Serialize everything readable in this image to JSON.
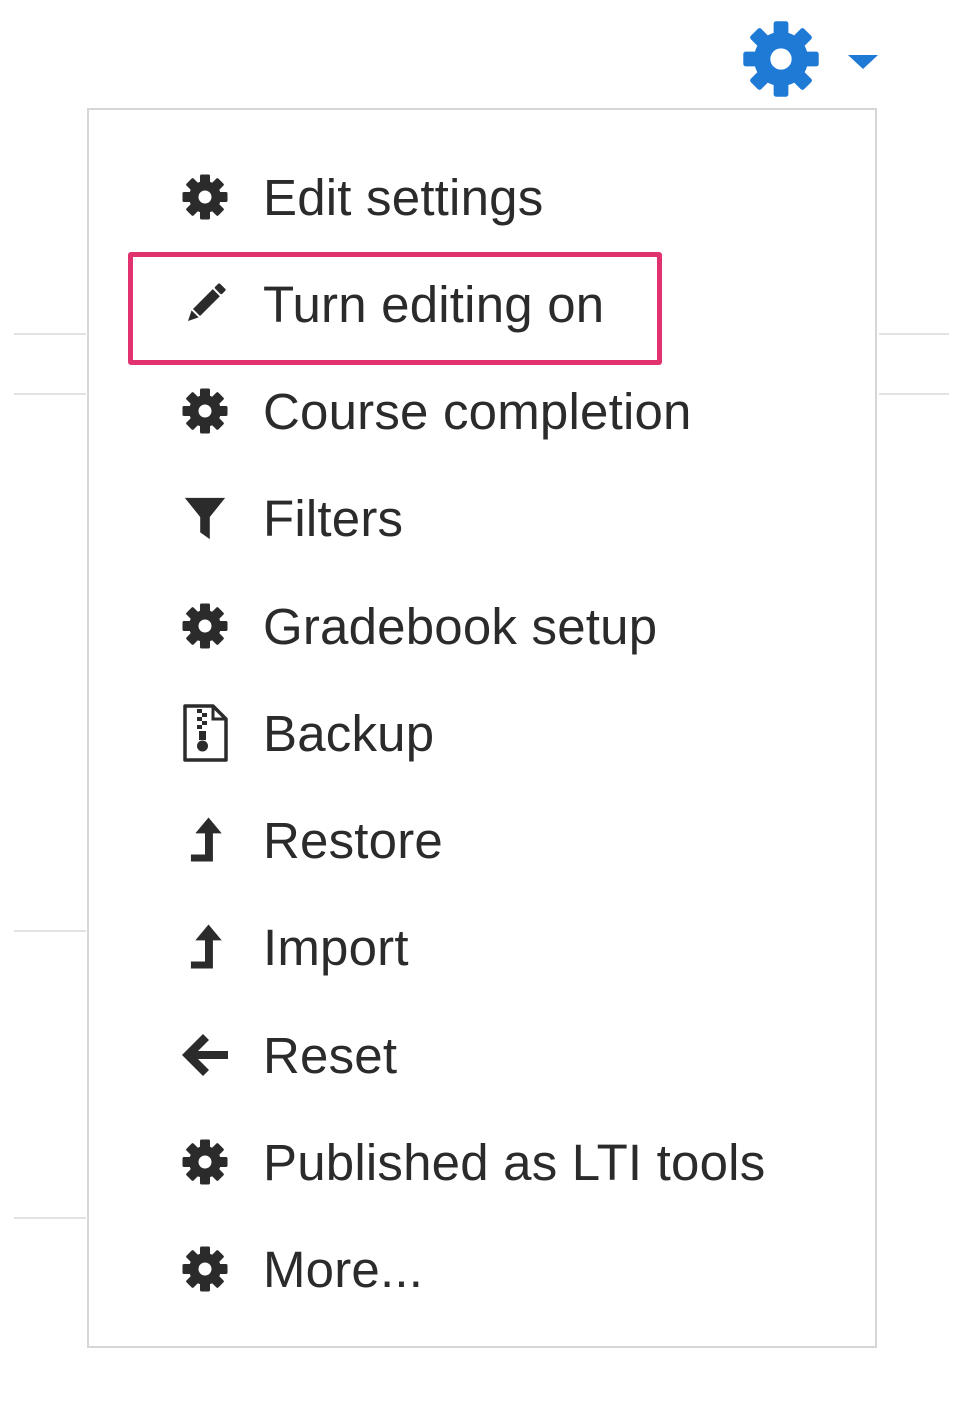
{
  "settings_menu": {
    "trigger": {
      "icon": "gear-icon",
      "caret_icon": "caret-down-icon",
      "color": "#1f7ad6"
    },
    "items": [
      {
        "label": "Edit settings",
        "icon": "gear-icon"
      },
      {
        "label": "Turn editing on",
        "icon": "pencil-icon",
        "highlighted": true
      },
      {
        "label": "Course completion",
        "icon": "gear-icon"
      },
      {
        "label": "Filters",
        "icon": "filter-icon"
      },
      {
        "label": "Gradebook setup",
        "icon": "gear-icon"
      },
      {
        "label": "Backup",
        "icon": "file-zip-icon"
      },
      {
        "label": "Restore",
        "icon": "level-up-icon"
      },
      {
        "label": "Import",
        "icon": "level-up-icon"
      },
      {
        "label": "Reset",
        "icon": "arrow-left-icon"
      },
      {
        "label": "Published as LTI tools",
        "icon": "gear-icon"
      },
      {
        "label": "More...",
        "icon": "gear-icon"
      }
    ],
    "highlight_color": "#e0326f",
    "text_color": "#2b2b2b"
  }
}
